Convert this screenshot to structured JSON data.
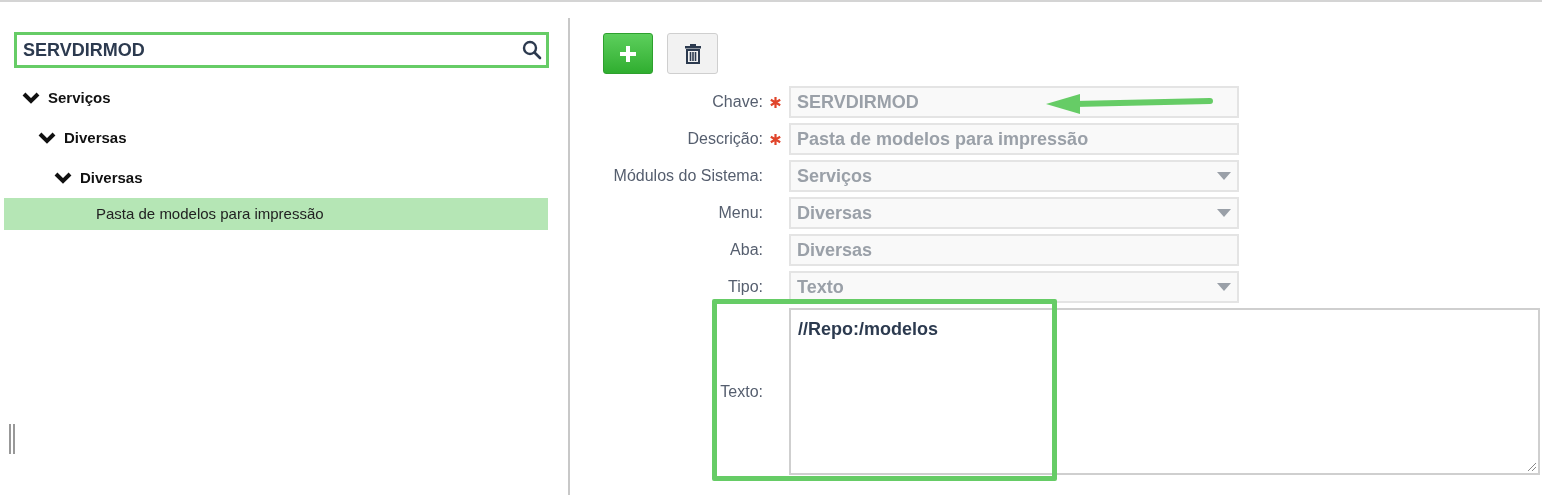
{
  "search": {
    "value": "SERVDIRMOD"
  },
  "tree": [
    {
      "label": "Serviços",
      "expanded": true,
      "selected": false,
      "children": [
        {
          "label": "Diversas",
          "expanded": true,
          "selected": false,
          "children": [
            {
              "label": "Diversas",
              "expanded": true,
              "selected": false,
              "children": [
                {
                  "label": "Pasta de modelos para impressão",
                  "selected": true
                }
              ]
            }
          ]
        }
      ]
    }
  ],
  "toolbar": [
    {
      "kind": "add"
    },
    {
      "kind": "delete"
    }
  ],
  "form": [
    {
      "label": "Chave:",
      "value": "SERVDIRMOD",
      "required": true,
      "kind": "text"
    },
    {
      "label": "Descrição:",
      "value": "Pasta de modelos para impressão",
      "required": true,
      "kind": "text"
    },
    {
      "label": "Módulos do Sistema:",
      "value": "Serviços",
      "required": false,
      "kind": "select"
    },
    {
      "label": "Menu:",
      "value": "Diversas",
      "required": false,
      "kind": "select"
    },
    {
      "label": "Aba:",
      "value": "Diversas",
      "required": false,
      "kind": "text"
    },
    {
      "label": "Tipo:",
      "value": "Texto",
      "required": false,
      "kind": "select"
    },
    {
      "label": "Texto:",
      "value": "//Repo:/modelos",
      "required": false,
      "kind": "textarea"
    }
  ]
}
